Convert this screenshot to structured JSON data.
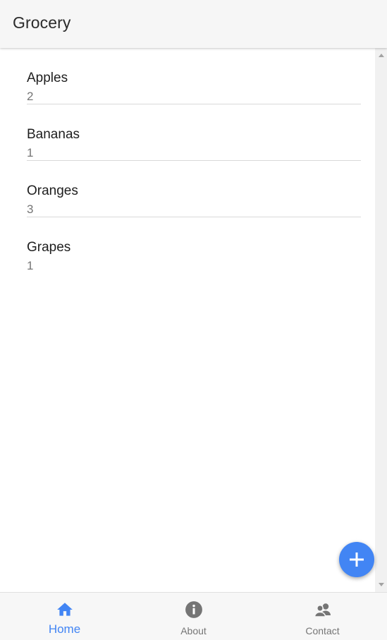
{
  "app_bar": {
    "title": "Grocery"
  },
  "items": [
    {
      "name": "Apples",
      "quantity": "2"
    },
    {
      "name": "Bananas",
      "quantity": "1"
    },
    {
      "name": "Oranges",
      "quantity": "3"
    },
    {
      "name": "Grapes",
      "quantity": "1"
    }
  ],
  "fab": {
    "icon": "plus-icon"
  },
  "nav": [
    {
      "label": "Home",
      "icon": "home-icon",
      "active": true
    },
    {
      "label": "About",
      "icon": "info-icon",
      "active": false
    },
    {
      "label": "Contact",
      "icon": "contact-icon",
      "active": false
    }
  ],
  "colors": {
    "accent": "#4285f4",
    "nav_inactive": "#757575",
    "app_bar_bg": "#f6f6f6"
  }
}
